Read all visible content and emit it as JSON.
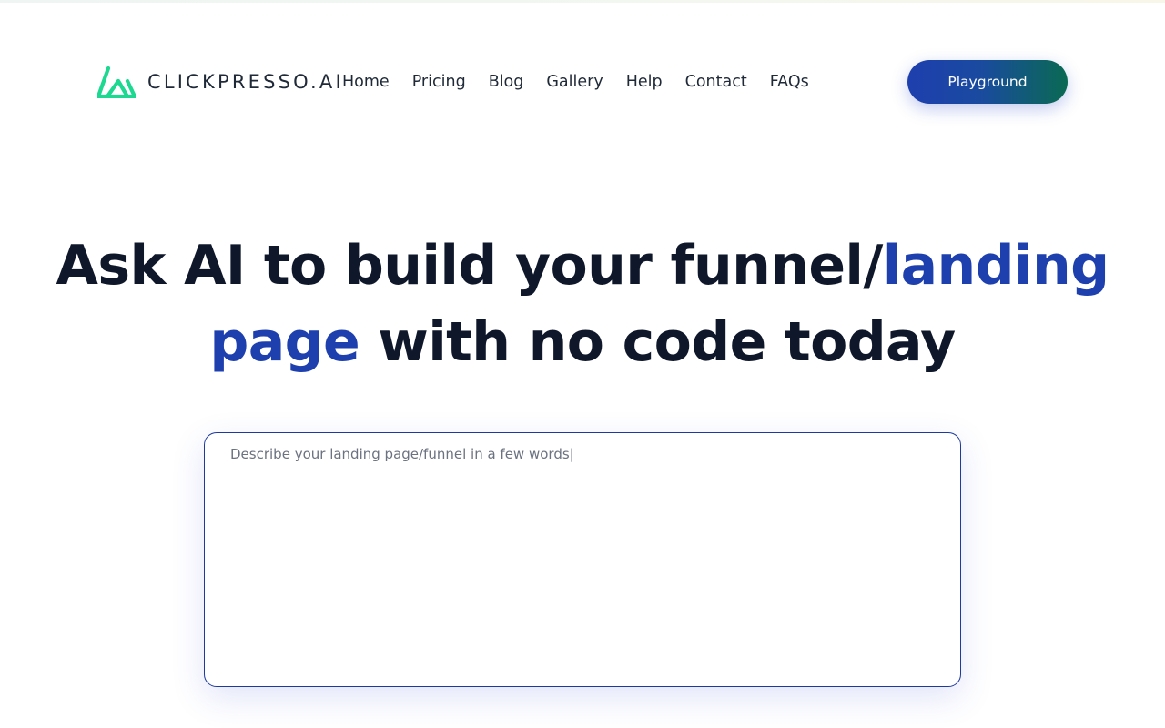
{
  "brand": {
    "name": "CLICKPRESSO.AI",
    "logo_icon": "triangle-logo-icon",
    "color": "#1dd890"
  },
  "nav": {
    "links": [
      "Home",
      "Pricing",
      "Blog",
      "Gallery",
      "Help",
      "Contact",
      "FAQs"
    ]
  },
  "cta": {
    "label": "Playground"
  },
  "hero": {
    "part1": "Ask AI to build your funnel/",
    "highlight": "landing page",
    "part2": " with no code today",
    "accent_color": "#1e40af"
  },
  "prompt": {
    "placeholder": "Describe your landing page/funnel in a few words|",
    "value": ""
  }
}
